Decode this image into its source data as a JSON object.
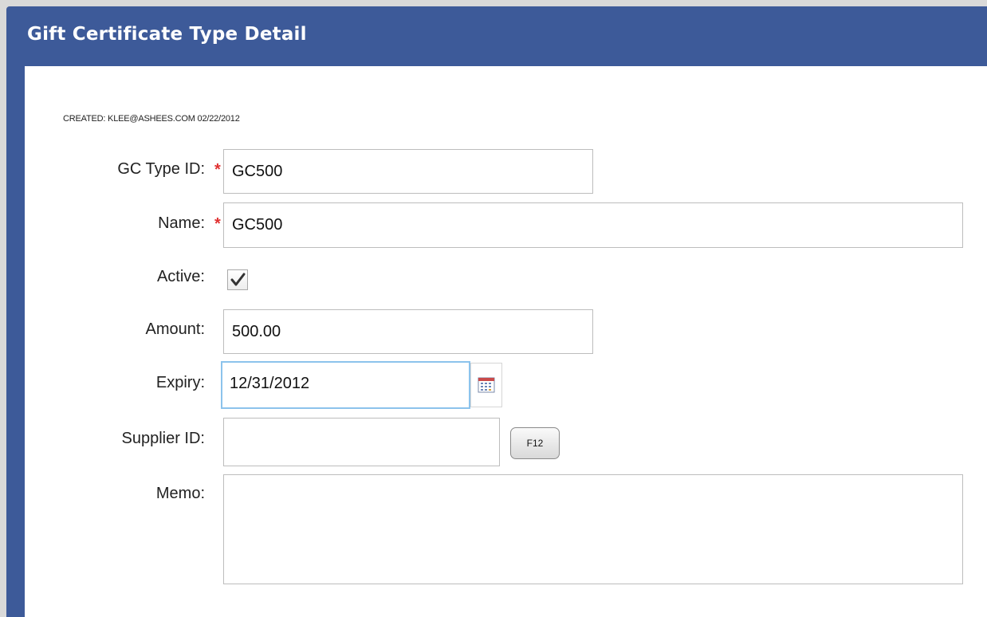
{
  "window": {
    "title": "Gift Certificate Type Detail"
  },
  "meta": {
    "created": "CREATED: KLEE@ASHEES.COM 02/22/2012"
  },
  "form": {
    "gc_type_id": {
      "label": "GC Type ID:",
      "required_mark": "*",
      "value": "GC500"
    },
    "name": {
      "label": "Name:",
      "required_mark": "*",
      "value": "GC500"
    },
    "active": {
      "label": "Active:",
      "checked": true
    },
    "amount": {
      "label": "Amount:",
      "value": "500.00"
    },
    "expiry": {
      "label": "Expiry:",
      "value": "12/31/2012",
      "calendar_icon": "calendar-icon"
    },
    "supplier_id": {
      "label": "Supplier ID:",
      "value": "",
      "lookup_button": "F12"
    },
    "memo": {
      "label": "Memo:",
      "value": ""
    }
  },
  "colors": {
    "header_bg": "#3d5a99",
    "required": "#e03030",
    "focus_border": "#8cc3ec"
  }
}
